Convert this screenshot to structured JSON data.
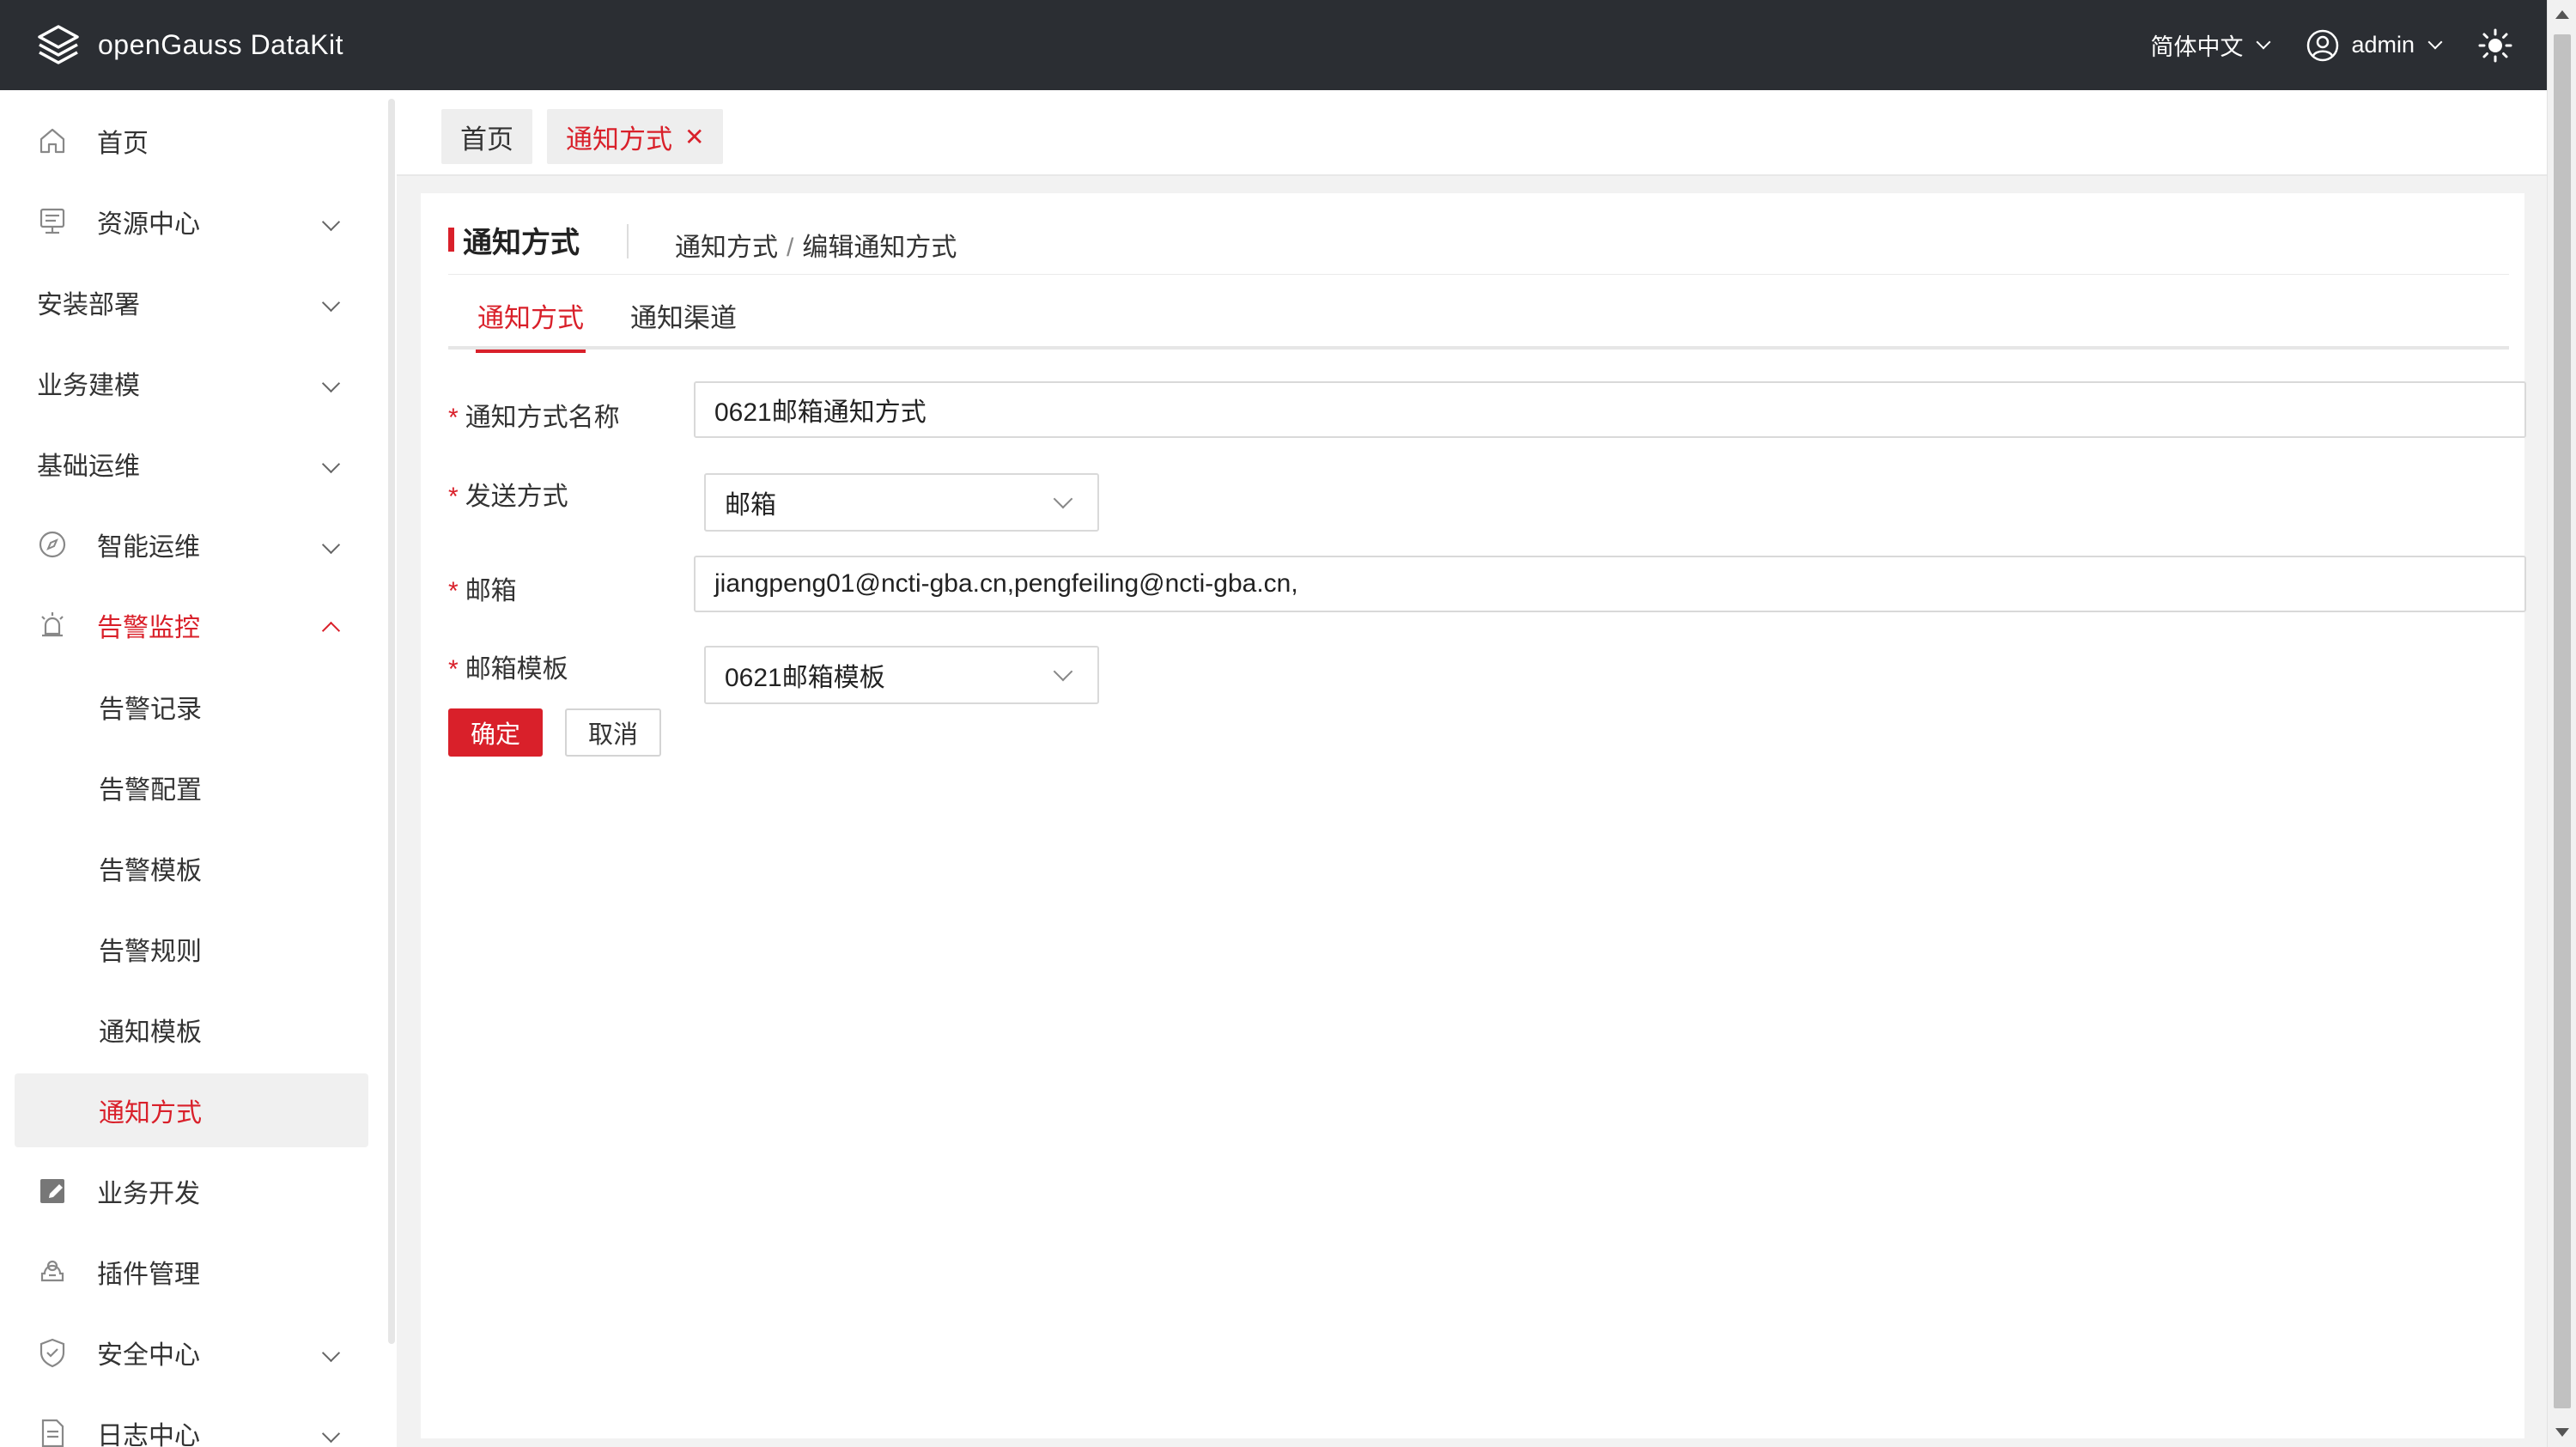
{
  "header": {
    "app_title": "openGauss DataKit",
    "language": "简体中文",
    "user": "admin",
    "icons": [
      "logo-icon",
      "user-icon",
      "theme-sun-icon"
    ]
  },
  "sidebar": {
    "items": [
      {
        "label": "首页",
        "icon": "home-icon"
      },
      {
        "label": "资源中心",
        "icon": "server-icon"
      },
      {
        "label": "安装部署"
      },
      {
        "label": "业务建模"
      },
      {
        "label": "基础运维"
      },
      {
        "label": "智能运维",
        "icon": "compass-icon"
      },
      {
        "label": "告警监控",
        "icon": "alarm-icon"
      },
      {
        "label": "告警记录"
      },
      {
        "label": "告警配置"
      },
      {
        "label": "告警模板"
      },
      {
        "label": "告警规则"
      },
      {
        "label": "通知模板"
      },
      {
        "label": "通知方式"
      },
      {
        "label": "业务开发",
        "icon": "edit-icon"
      },
      {
        "label": "插件管理",
        "icon": "plugin-icon"
      },
      {
        "label": "安全中心",
        "icon": "shield-icon"
      },
      {
        "label": "日志中心",
        "icon": "log-icon"
      }
    ]
  },
  "tabs": {
    "home": "首页",
    "current": "通知方式",
    "close": "✕"
  },
  "page": {
    "title": "通知方式",
    "breadcrumb": [
      "通知方式",
      "/",
      "编辑通知方式"
    ],
    "sub_tabs": [
      "通知方式",
      "通知渠道"
    ]
  },
  "form": {
    "required_mark": "*",
    "name_label": "通知方式名称",
    "name_value": "0621邮箱通知方式",
    "send_label": "发送方式",
    "send_value": "邮箱",
    "email_label": "邮箱",
    "email_value": "jiangpeng01@ncti-gba.cn,pengfeiling@ncti-gba.cn,",
    "template_label": "邮箱模板",
    "template_value": "0621邮箱模板",
    "ok": "确定",
    "cancel": "取消"
  },
  "colors": {
    "accent": "#d9202a",
    "header_bg": "#2b2e33"
  }
}
